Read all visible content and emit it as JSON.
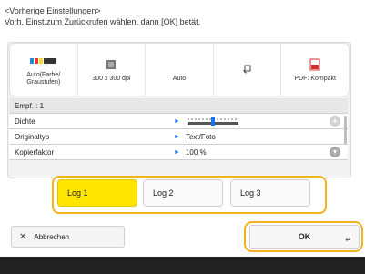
{
  "header": {
    "line1": "<Vorherige Einstellungen>",
    "line2": "Vorh. Einst.zum Zurückrufen wählen, dann [OK] betät."
  },
  "settings_summary": [
    {
      "label": "Auto(Farbe/ Graustufen)",
      "icon": "color-mode-icon"
    },
    {
      "label": "300 x 300 dpi",
      "icon": "resolution-icon"
    },
    {
      "label": "Auto",
      "icon": ""
    },
    {
      "label": "",
      "icon": "rotate-icon"
    },
    {
      "label": "PDF: Kompakt",
      "icon": "pdf-icon"
    }
  ],
  "detail_rows": [
    {
      "name": "Empf.        : 1",
      "value": ""
    },
    {
      "name": "Dichte",
      "value": ""
    },
    {
      "name": "Originaltyp",
      "value": "Text/Foto"
    },
    {
      "name": "Kopierfaktor",
      "value": "100 %"
    }
  ],
  "logs": [
    {
      "label": "Log 1",
      "selected": true
    },
    {
      "label": "Log 2",
      "selected": false
    },
    {
      "label": "Log 3",
      "selected": false
    }
  ],
  "buttons": {
    "cancel": "Abbrechen",
    "ok": "OK"
  },
  "colors": {
    "accent": "#f4b21b",
    "selected_log": "#ffe600",
    "link_blue": "#1a73e8"
  }
}
